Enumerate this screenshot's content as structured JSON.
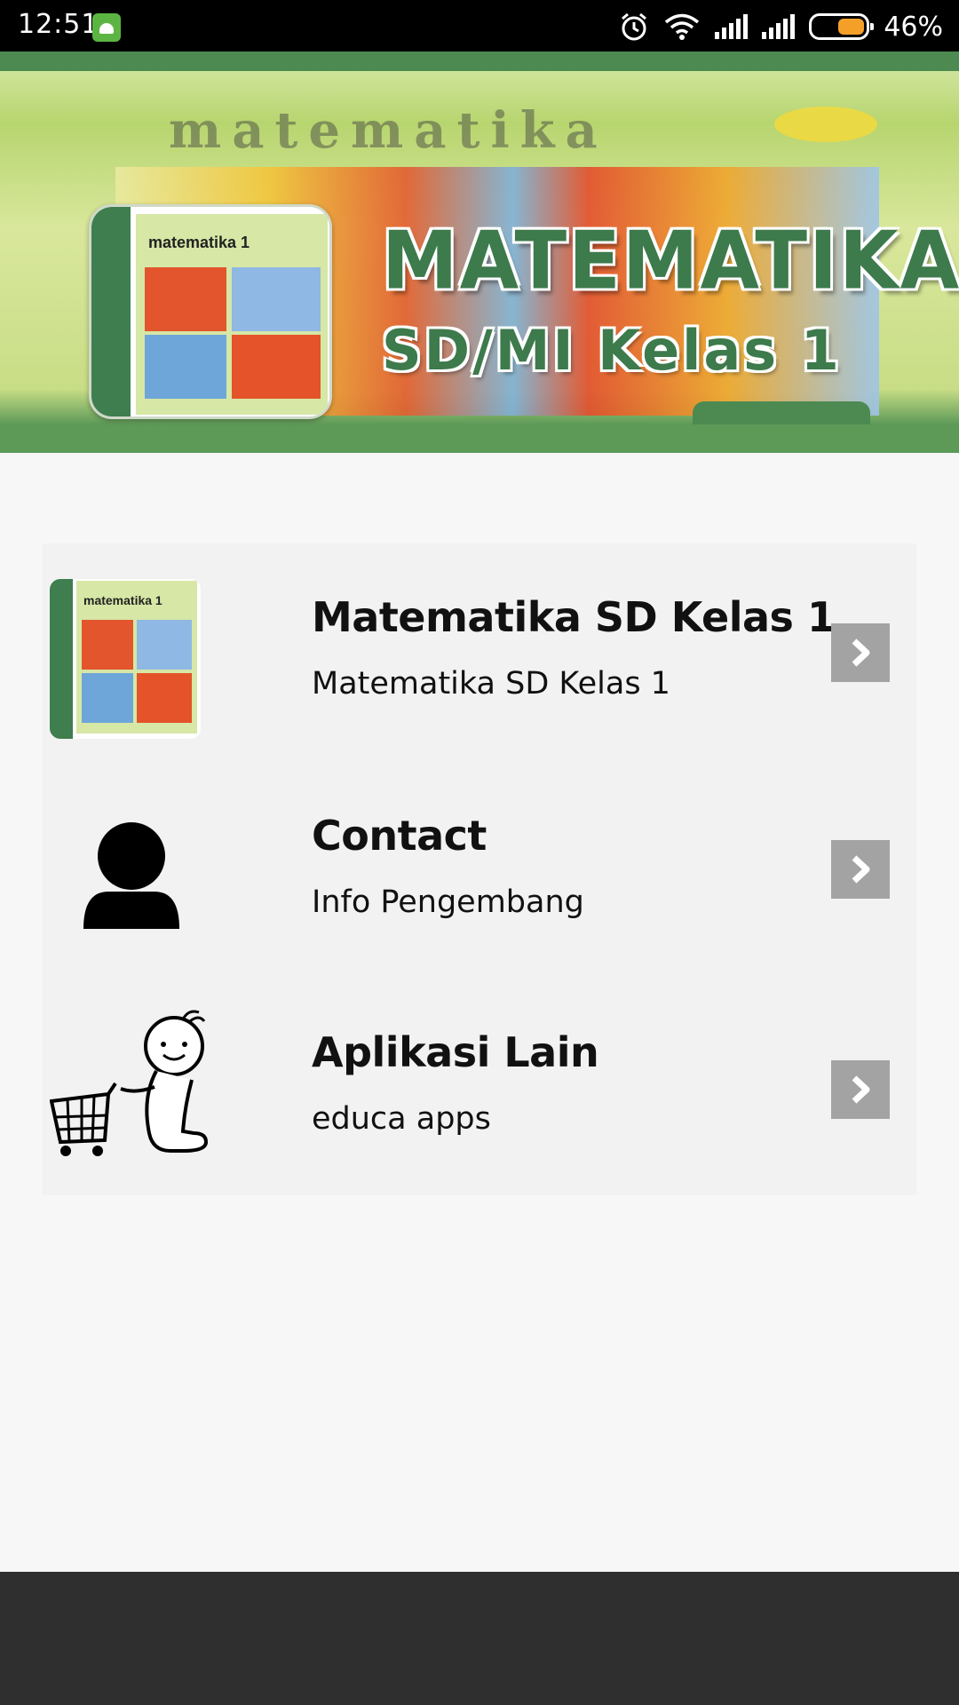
{
  "status_bar": {
    "time": "12:51",
    "battery_percent": "46%",
    "battery_level": 0.46,
    "icons": [
      "android-notification-icon",
      "alarm-icon",
      "wifi-icon",
      "signal-icon",
      "signal-icon",
      "battery-icon"
    ]
  },
  "banner": {
    "title": "MATEMATIKA",
    "subtitle": "SD/MI Kelas 1",
    "book_cover_title": "matematika 1",
    "background_text": "matematika"
  },
  "menu": {
    "items": [
      {
        "title": "Matematika SD Kelas 1",
        "subtitle": "Matematika SD Kelas 1",
        "thumb": "book-cover-icon",
        "thumb_text": "matematika 1"
      },
      {
        "title": "Contact",
        "subtitle": "Info Pengembang",
        "thumb": "person-icon"
      },
      {
        "title": "Aplikasi Lain",
        "subtitle": "educa apps",
        "thumb": "shopping-cart-character-icon"
      }
    ]
  },
  "colors": {
    "accent_green": "#3d7a4c",
    "arrow_button": "#a3a3a3",
    "panel_bg": "#f2f2f2",
    "nav_bar": "#2f2f2f"
  }
}
